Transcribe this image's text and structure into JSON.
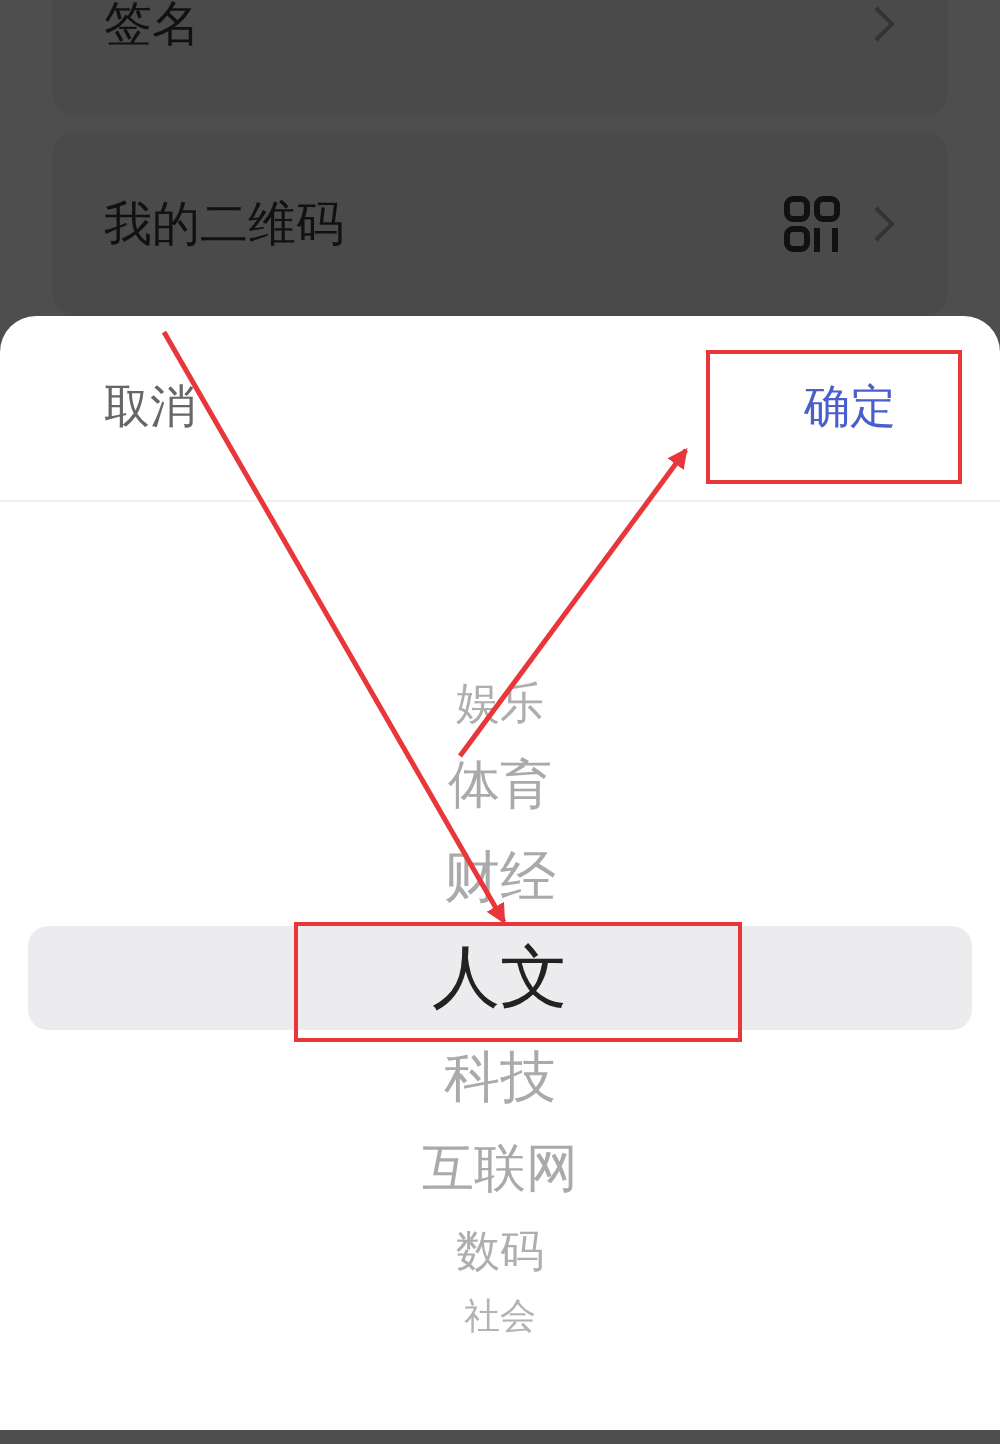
{
  "settings_rows": [
    {
      "label": "签名",
      "kind": "plain"
    },
    {
      "label": "我的二维码",
      "kind": "qr"
    }
  ],
  "picker_sheet": {
    "cancel": "取消",
    "confirm": "确定",
    "options": [
      {
        "label": "娱乐",
        "selected": false
      },
      {
        "label": "体育",
        "selected": false
      },
      {
        "label": "财经",
        "selected": false
      },
      {
        "label": "人文",
        "selected": true
      },
      {
        "label": "科技",
        "selected": false
      },
      {
        "label": "互联网",
        "selected": false
      },
      {
        "label": "数码",
        "selected": false
      },
      {
        "label": "社会",
        "selected": false
      }
    ]
  }
}
